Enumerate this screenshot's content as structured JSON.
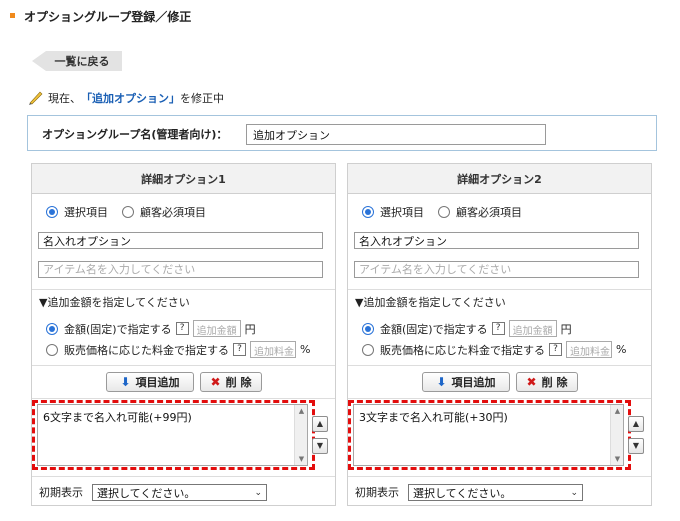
{
  "page": {
    "title": "オプショングループ登録／修正"
  },
  "back_button": {
    "label": "一覧に戻る"
  },
  "editing": {
    "prefix": "現在、",
    "quote_open": "「",
    "name": "追加オプション",
    "quote_close": "」",
    "suffix": "を修正中"
  },
  "group": {
    "label": "オプショングループ名(管理者向け)：",
    "value": "追加オプション"
  },
  "panels": [
    {
      "header": "詳細オプション1",
      "type_options": [
        "選択項目",
        "顧客必須項目"
      ],
      "selected_type": "選択項目",
      "option_name": "名入れオプション",
      "item_placeholder": "アイテム名を入力してください",
      "price_heading": "▼追加金額を指定してください",
      "price_fixed_label": "金額(固定)で指定する",
      "price_fixed_placeholder": "追加金額",
      "price_fixed_unit": "円",
      "price_rate_label": "販売価格に応じた料金で指定する",
      "price_rate_placeholder": "追加料金",
      "price_rate_unit": "%",
      "help_mark": "?",
      "add_button": "項目追加",
      "delete_button": "削 除",
      "items": [
        "6文字まで名入れ可能(+99円)"
      ],
      "initial_label": "初期表示",
      "initial_value": "選択してください。"
    },
    {
      "header": "詳細オプション2",
      "type_options": [
        "選択項目",
        "顧客必須項目"
      ],
      "selected_type": "選択項目",
      "option_name": "名入れオプション",
      "item_placeholder": "アイテム名を入力してください",
      "price_heading": "▼追加金額を指定してください",
      "price_fixed_label": "金額(固定)で指定する",
      "price_fixed_placeholder": "追加金額",
      "price_fixed_unit": "円",
      "price_rate_label": "販売価格に応じた料金で指定する",
      "price_rate_placeholder": "追加料金",
      "price_rate_unit": "%",
      "help_mark": "?",
      "add_button": "項目追加",
      "delete_button": "削 除",
      "items": [
        "3文字まで名入れ可能(+30円)"
      ],
      "initial_label": "初期表示",
      "initial_value": "選択してください。"
    }
  ],
  "colors": {
    "accent": "#f08a1c",
    "link": "#1a5fb4",
    "highlight": "#e30d0d",
    "radio": "#2a73d8"
  },
  "icons": {
    "up": "▲",
    "down": "▼",
    "caret": "⌄",
    "add": "⬇",
    "delete": "✖"
  }
}
